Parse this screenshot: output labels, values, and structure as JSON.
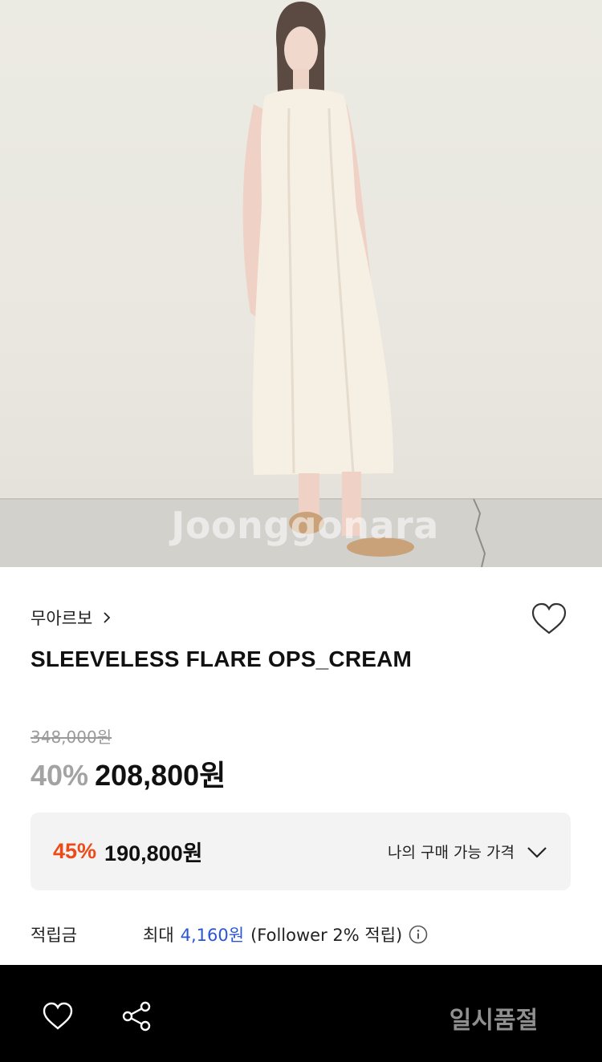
{
  "product": {
    "brand": "무아르보",
    "title": "SLEEVELESS FLARE OPS_CREAM",
    "original_price": "348,000원",
    "discount_rate": "40%",
    "sale_price": "208,800원",
    "watermark": "Joonggonara"
  },
  "my_price": {
    "discount_rate": "45%",
    "price": "190,800원",
    "label": "나의 구매 가능 가격"
  },
  "points": {
    "label": "적립금",
    "prefix": "최대",
    "amount": "4,160원",
    "note": "(Follower 2% 적립)"
  },
  "bottom_bar": {
    "status": "일시품절"
  },
  "colors": {
    "accent_orange": "#ee4a17",
    "link_blue": "#2a56d6",
    "bar_bg": "#000000"
  }
}
